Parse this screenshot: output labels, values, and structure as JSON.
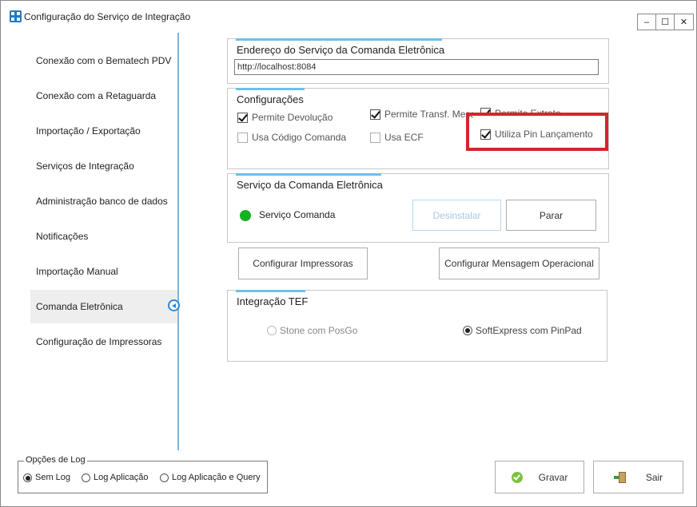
{
  "window": {
    "title": "Configuração do Serviço de Integração",
    "buttons": {
      "minimize": "–",
      "maximize": "☐",
      "close": "✕"
    }
  },
  "sidebar": {
    "items": [
      {
        "label": "Conexão com o Bematech PDV"
      },
      {
        "label": "Conexão com a Retaguarda"
      },
      {
        "label": "Importação / Exportação"
      },
      {
        "label": "Serviços de Integração"
      },
      {
        "label": "Administração banco de dados"
      },
      {
        "label": "Notificações"
      },
      {
        "label": "Importação Manual"
      },
      {
        "label": "Comanda Eletrônica",
        "active": true
      },
      {
        "label": "Configuração de Impressoras"
      }
    ]
  },
  "endereco": {
    "title": "Endereço do Serviço da Comanda Eletrônica",
    "url_value": "http://localhost:8084"
  },
  "configuracoes": {
    "title": "Configurações",
    "options": [
      {
        "label": "Permite Devolução",
        "checked": true
      },
      {
        "label": "Permite Transf. Mesa",
        "checked": true
      },
      {
        "label": "Permite Extrato",
        "checked": true
      },
      {
        "label": "Usa Código Comanda",
        "checked": false
      },
      {
        "label": "Usa ECF",
        "checked": false
      },
      {
        "label": "Utiliza Pin Lançamento",
        "checked": true
      }
    ]
  },
  "servico": {
    "title": "Serviço da Comanda Eletrônica",
    "status_label": "Serviço Comanda",
    "status_color": "#17b022",
    "uninstall_label": "Desinstalar",
    "stop_label": "Parar"
  },
  "actions": {
    "configure_printers": "Configurar Impressoras",
    "configure_message": "Configurar Mensagem Operacional"
  },
  "tef": {
    "title": "Integração TEF",
    "options": [
      {
        "label": "Stone com PosGo",
        "selected": false,
        "enabled": false
      },
      {
        "label": "SoftExpress com PinPad",
        "selected": true,
        "enabled": true
      }
    ]
  },
  "log": {
    "title": "Opções de Log",
    "options": [
      {
        "label": "Sem Log",
        "selected": true
      },
      {
        "label": "Log Aplicação",
        "selected": false
      },
      {
        "label": "Log Aplicação e Query",
        "selected": false
      }
    ]
  },
  "footer": {
    "save_label": "Gravar",
    "exit_label": "Sair"
  },
  "colors": {
    "accent": "#6ebfe8",
    "highlight": "#d3262c"
  }
}
